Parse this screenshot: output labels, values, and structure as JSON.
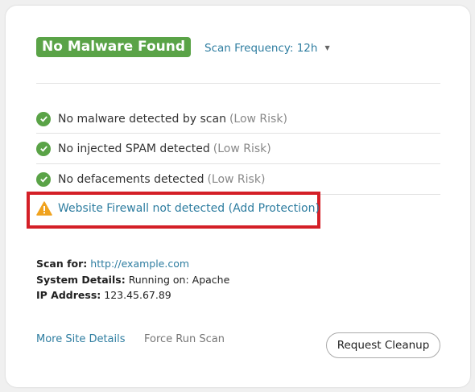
{
  "header": {
    "status_badge": "No Malware Found",
    "scan_frequency": "Scan Frequency: 12h"
  },
  "checks": [
    {
      "text": "No malware detected by scan",
      "risk": "(Low Risk)",
      "status": "ok"
    },
    {
      "text": "No injected SPAM detected",
      "risk": "(Low Risk)",
      "status": "ok"
    },
    {
      "text": "No defacements detected",
      "risk": "(Low Risk)",
      "status": "ok"
    }
  ],
  "warning": {
    "text": "Website Firewall not detected (Add Protection)",
    "status": "warning"
  },
  "details": {
    "scan_for_label": "Scan for:",
    "scan_for_value": "http://example.com",
    "system_label": "System Details:",
    "system_value": "Running on: Apache",
    "ip_label": "IP Address:",
    "ip_value": "123.45.67.89"
  },
  "footer": {
    "more_details": "More Site Details",
    "force_scan": "Force Run Scan",
    "request_cleanup": "Request Cleanup"
  },
  "colors": {
    "success": "#5aa347",
    "link": "#2e7da0",
    "warning": "#f0a21e",
    "highlight": "#d41f27"
  }
}
